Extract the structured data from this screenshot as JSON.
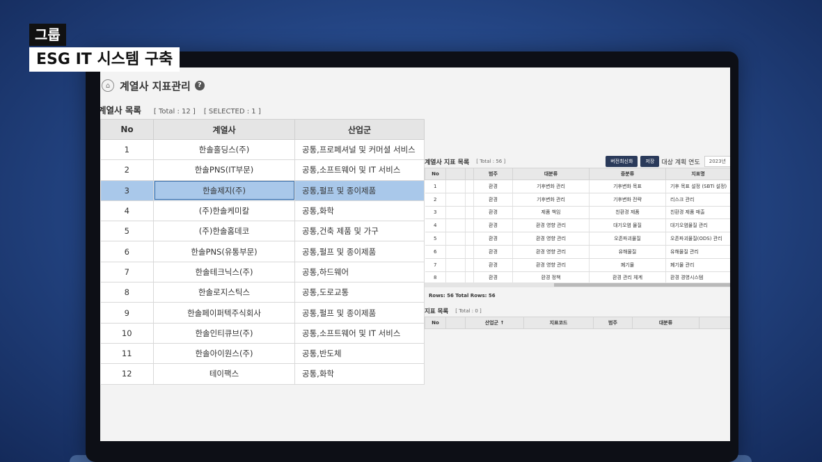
{
  "caption": {
    "line1": "그룹",
    "line2": "ESG IT 시스템 구축"
  },
  "page": {
    "title": "계열사 지표관리",
    "help_icon": "?"
  },
  "affiliates": {
    "title": "계열사 목록",
    "total": "[ Total : 12 ]",
    "selected": "[ SELECTED : 1 ]",
    "columns": [
      "No",
      "계열사",
      "산업군"
    ],
    "rows": [
      [
        "1",
        "한솔홀딩스(주)",
        "공통,프로페셔널 및 커머셜 서비스"
      ],
      [
        "2",
        "한솔PNS(IT부문)",
        "공통,소프트웨어 및 IT 서비스"
      ],
      [
        "3",
        "한솔제지(주)",
        "공통,펄프 및 종이제품"
      ],
      [
        "4",
        "(주)한솔케미칼",
        "공통,화학"
      ],
      [
        "5",
        "(주)한솔홈데코",
        "공통,건축 제품 및 가구"
      ],
      [
        "6",
        "한솔PNS(유통부문)",
        "공통,펄프 및 종이제품"
      ],
      [
        "7",
        "한솔테크닉스(주)",
        "공통,하드웨어"
      ],
      [
        "8",
        "한솔로지스틱스",
        "공통,도로교통"
      ],
      [
        "9",
        "한솔페이퍼텍주식회사",
        "공통,펄프 및 종이제품"
      ],
      [
        "10",
        "한솔인티큐브(주)",
        "공통,소프트웨어 및 IT 서비스"
      ],
      [
        "11",
        "한솔아이원스(주)",
        "공통,반도체"
      ],
      [
        "12",
        "테이팩스",
        "공통,화학"
      ]
    ],
    "selected_row": 2
  },
  "indicators": {
    "title": "계열사 지표 목록",
    "total": "[ Total : 56 ]",
    "btn_version": "버전최신화",
    "btn_save": "저장",
    "plan_label": "대상 계획 연도",
    "plan_year": "2023년",
    "columns": [
      "No",
      "",
      "",
      "범주",
      "대분류",
      "중분류",
      "지표명"
    ],
    "rows": [
      [
        "1",
        "환경",
        "기후변화 관리",
        "기후변화 목표",
        "기후 목표 설정 (SBTi 설정)"
      ],
      [
        "2",
        "환경",
        "기후변화 관리",
        "기후변화 전략",
        "리스크 관리"
      ],
      [
        "3",
        "환경",
        "제품 책임",
        "친환경 제품",
        "친환경 제품 매출"
      ],
      [
        "4",
        "환경",
        "환경 영향 관리",
        "대기오염 물질",
        "대기오염물질 관리"
      ],
      [
        "5",
        "환경",
        "환경 영향 관리",
        "오존파괴물질",
        "오존파괴물질(ODS) 관리"
      ],
      [
        "6",
        "환경",
        "환경 영향 관리",
        "유해물질",
        "유해물질 관리"
      ],
      [
        "7",
        "환경",
        "환경 영향 관리",
        "폐기물",
        "폐기물 관리"
      ],
      [
        "8",
        "환경",
        "환경 정책",
        "환경 관리 체계",
        "환경 경영시스템"
      ]
    ],
    "rows_label": "Rows: 56  Total Rows: 56"
  },
  "indicator_codes": {
    "title": "지표 목록",
    "total": "[ Total : 0 ]",
    "columns": [
      "No",
      "",
      "산업군 ↑",
      "지표코드",
      "범주",
      "대분류",
      ""
    ]
  },
  "colors": {
    "selected_row": "#a9c8ea",
    "button": "#2a3a5a",
    "background": "#26498a"
  }
}
